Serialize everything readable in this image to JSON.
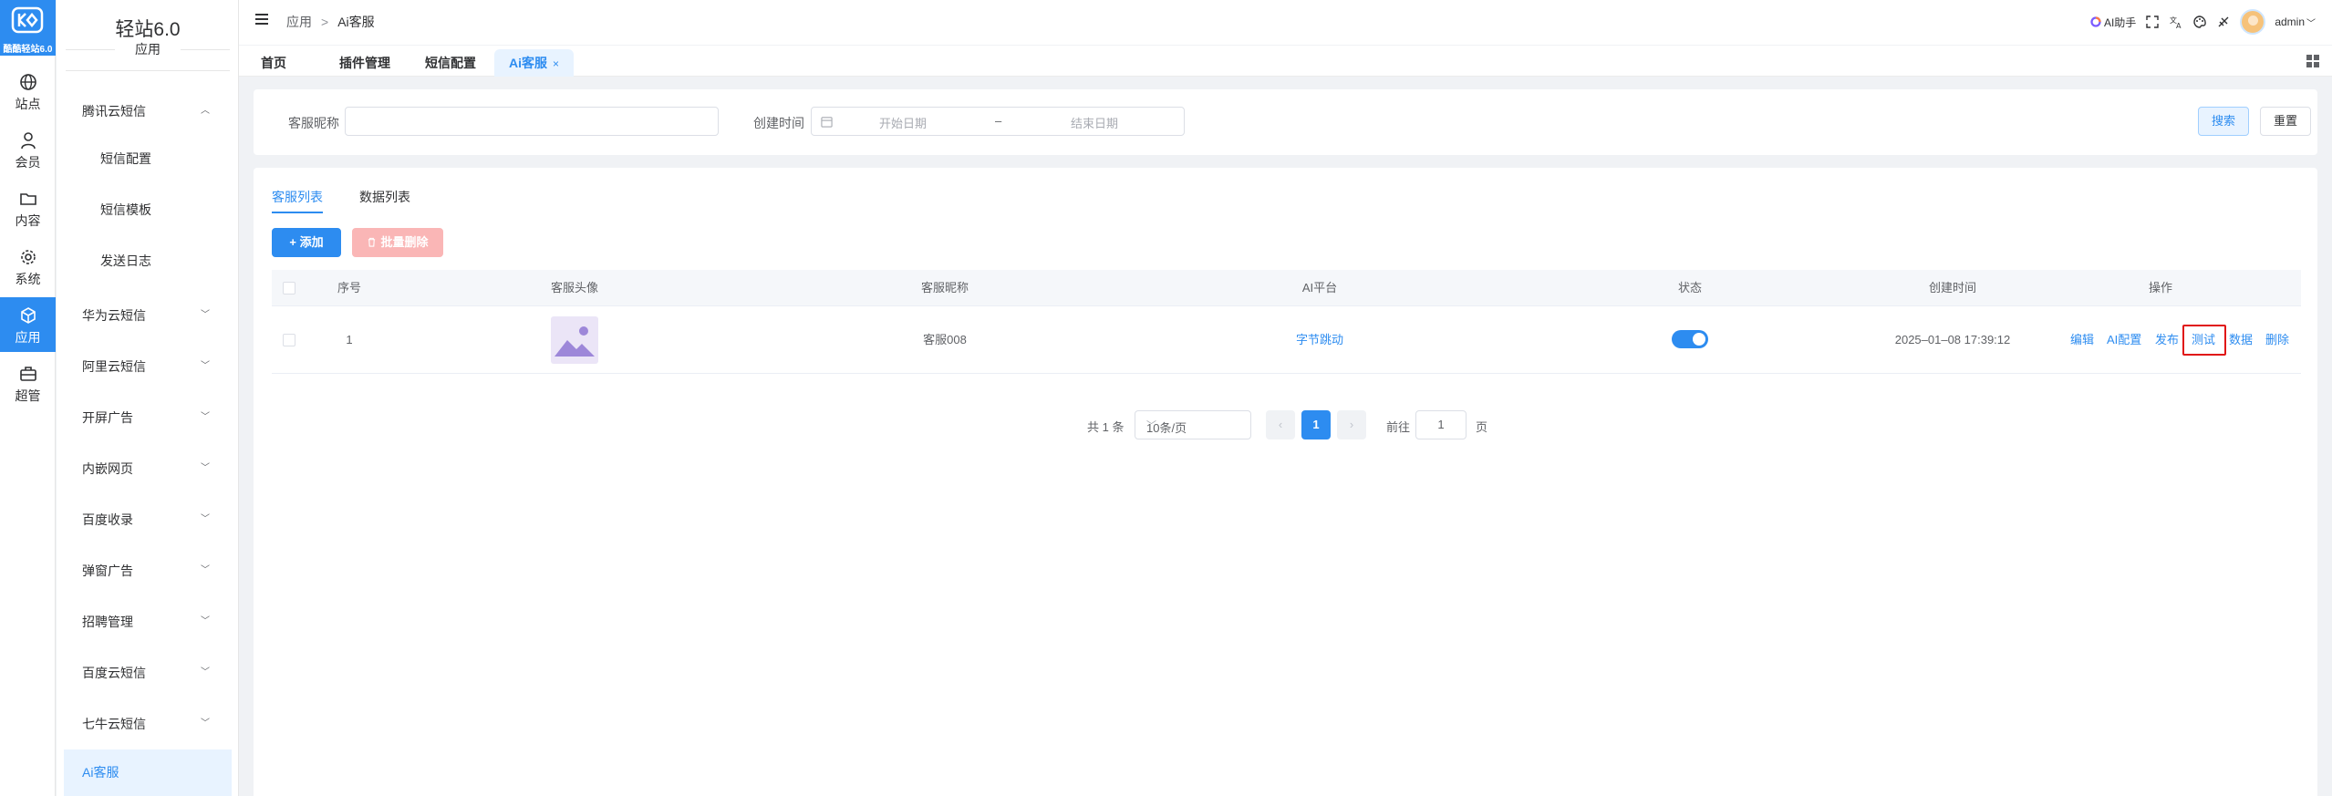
{
  "logo": {
    "brand": "酷酷轻站6.0"
  },
  "rail": [
    {
      "label": "站点",
      "icon": "globe-icon"
    },
    {
      "label": "会员",
      "icon": "user-icon"
    },
    {
      "label": "内容",
      "icon": "folder-icon"
    },
    {
      "label": "系统",
      "icon": "gear-icon"
    },
    {
      "label": "应用",
      "icon": "cube-icon",
      "active": true
    },
    {
      "label": "超管",
      "icon": "briefcase-icon"
    }
  ],
  "submenu": {
    "title": "轻站6.0",
    "subtitle": "应用",
    "groups": [
      {
        "label": "腾讯云短信",
        "expanded": true,
        "children": [
          "短信配置",
          "短信模板",
          "发送日志"
        ]
      },
      {
        "label": "华为云短信"
      },
      {
        "label": "阿里云短信"
      },
      {
        "label": "开屏广告"
      },
      {
        "label": "内嵌网页"
      },
      {
        "label": "百度收录"
      },
      {
        "label": "弹窗广告"
      },
      {
        "label": "招聘管理"
      },
      {
        "label": "百度云短信"
      },
      {
        "label": "七牛云短信"
      }
    ],
    "active": "Ai客服"
  },
  "header": {
    "breadcrumb": [
      "应用",
      "Ai客服"
    ],
    "breadcrumb_sep": ">",
    "ai_assistant": "AI助手",
    "user": "admin"
  },
  "tabs": [
    {
      "label": "首页"
    },
    {
      "label": "插件管理"
    },
    {
      "label": "短信配置"
    },
    {
      "label": "Ai客服",
      "active": true,
      "close": "×"
    }
  ],
  "search": {
    "nickname_label": "客服昵称",
    "nickname_value": "",
    "created_label": "创建时间",
    "start_placeholder": "开始日期",
    "range_sep": "–",
    "end_placeholder": "结束日期",
    "search_button": "搜索",
    "reset_button": "重置"
  },
  "main": {
    "tabs": [
      "客服列表",
      "数据列表"
    ],
    "add_button": "+ 添加",
    "bulk_delete_button": "批量删除",
    "columns": [
      "序号",
      "客服头像",
      "客服昵称",
      "AI平台",
      "状态",
      "创建时间",
      "操作"
    ],
    "rows": [
      {
        "index": "1",
        "nickname": "客服008",
        "platform": "字节跳动",
        "status_on": true,
        "created": "2025–01–08 17:39:12",
        "ops": [
          "编辑",
          "AI配置",
          "发布",
          "测试",
          "数据",
          "删除"
        ]
      }
    ],
    "pagination": {
      "total": "共 1 条",
      "page_size": "10条/页",
      "current": "1",
      "go_label": "前往",
      "go_value": "1",
      "page_suffix": "页"
    }
  },
  "colors": {
    "primary": "#2d8cf0",
    "highlight": "#e01515"
  }
}
